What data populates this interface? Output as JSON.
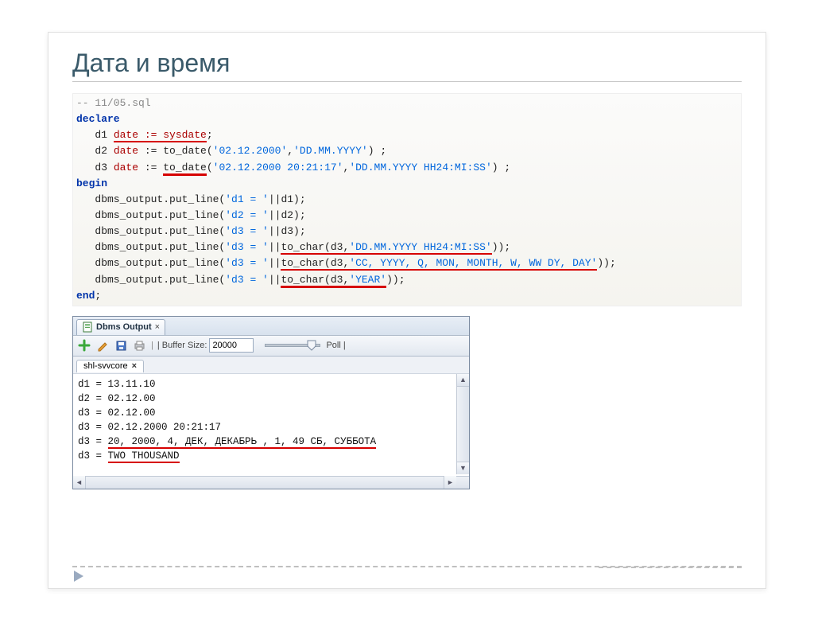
{
  "slide": {
    "title": "Дата и время"
  },
  "code": {
    "comment": "-- 11/05.sql",
    "kw_declare": "declare",
    "d1_var": "d1 ",
    "d1_type": "date := sysdate",
    "d1_tail": ";",
    "d2_var": "d2 ",
    "d2_type": "date",
    "d2_expr": " := to_date(",
    "d2_s1": "'02.12.2000'",
    "d2_mid": ",",
    "d2_s2": "'DD.MM.YYYY'",
    "d2_tail": ") ;",
    "d3_var": "d3 ",
    "d3_type": "date",
    "d3_expr": " := ",
    "d3_fn": "to_date",
    "d3_open": "(",
    "d3_s1": "'02.12.2000 20:21:17'",
    "d3_mid": ",",
    "d3_s2": "'DD.MM.YYYY HH24:MI:SS'",
    "d3_tail": ") ;",
    "kw_begin": "begin",
    "l1a": "dbms_output.put_line(",
    "l1s": "'d1 = '",
    "l1b": "||d1);",
    "l2a": "dbms_output.put_line(",
    "l2s": "'d2 = '",
    "l2b": "||d2);",
    "l3a": "dbms_output.put_line(",
    "l3s": "'d3 = '",
    "l3b": "||d3);",
    "l4a": "dbms_output.put_line(",
    "l4s": "'d3 = '",
    "l4m": "||",
    "l4fn": "to_char(d3,",
    "l4fs": "'DD.MM.YYYY HH24:MI:SS'",
    "l4t": "));",
    "l5a": "dbms_output.put_line(",
    "l5s": "'d3 = '",
    "l5m": "||",
    "l5fn": "to_char(d3,",
    "l5fs": "'CC, YYYY, Q, MON, MONTH, W, WW DY, DAY'",
    "l5t": "));",
    "l6a": "dbms_output.put_line(",
    "l6s": "'d3 = '",
    "l6m": "||",
    "l6fn": "to_char(d3,",
    "l6fs": "'YEAR'",
    "l6t": "));",
    "kw_end": "end",
    "end_tail": ";"
  },
  "panel": {
    "tab_label": "Dbms Output",
    "buffer_label": "| Buffer Size:",
    "buffer_value": "20000",
    "poll_label": "Poll |",
    "subtab_label": "shl-svvcore"
  },
  "output": {
    "l1": "d1 = 13.11.10",
    "l2": "d2 = 02.12.00",
    "l3": "d3 = 02.12.00",
    "l4": "d3 = 02.12.2000 20:21:17",
    "l5": "d3 = ",
    "l5_u": "20, 2000, 4, ДЕК, ДЕКАБРЬ , 1, 49 СБ, СУББОТА",
    "l6": "d3 = ",
    "l6_u": "TWO THOUSAND"
  }
}
